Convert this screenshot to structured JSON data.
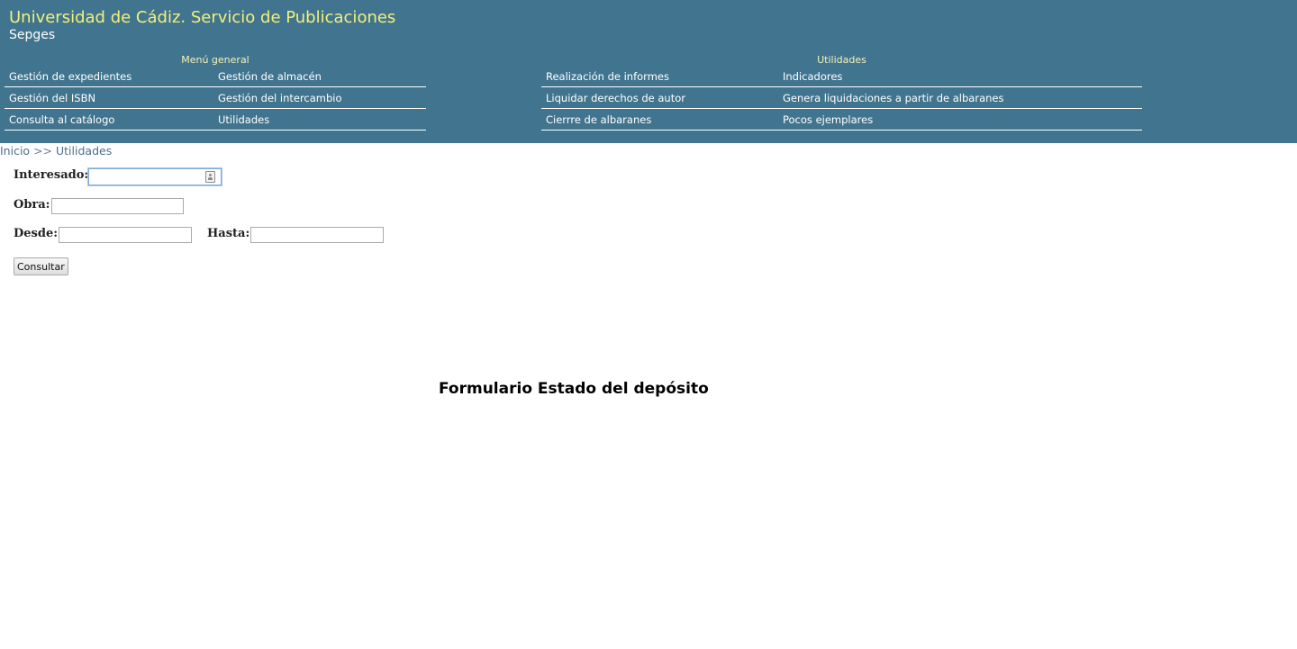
{
  "header": {
    "title": "Universidad de Cádiz. Servicio de Publicaciones",
    "subtitle": "Sepges"
  },
  "menu_general": {
    "heading": "Menú general",
    "items": [
      "Gestión de expedientes",
      "Gestión de almacén",
      "Gestión del ISBN",
      "Gestión del intercambio",
      "Consulta al catálogo",
      "Utilidades"
    ]
  },
  "utilidades_menu": {
    "heading": "Utilidades",
    "items": [
      "Realización de informes",
      "Indicadores",
      "Liquidar derechos de autor",
      "Genera liquidaciones a partir de albaranes",
      "Cierrre de albaranes",
      "Pocos ejemplares"
    ]
  },
  "breadcrumb": {
    "home": "Inicio",
    "separator": ">>",
    "current": "Utilidades"
  },
  "form": {
    "interesado_label": "Interesado:",
    "interesado_value": "",
    "obra_label": "Obra:",
    "obra_value": "",
    "desde_label": "Desde:",
    "desde_value": "",
    "hasta_label": "Hasta:",
    "hasta_value": "",
    "submit_label": "Consultar",
    "title": "Formulario Estado del depósito"
  },
  "colors": {
    "header_bg": "#41758f",
    "title_text": "#f4f07a",
    "menu_text": "#ffffff"
  }
}
